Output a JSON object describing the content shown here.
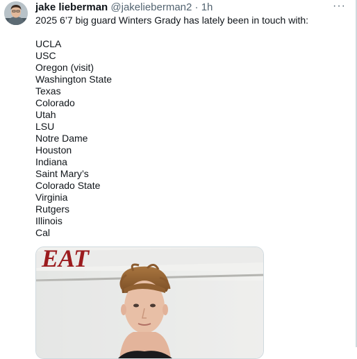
{
  "tweet": {
    "author_name": "jake lieberman",
    "handle": "@jakelieberman2",
    "separator": "·",
    "time": "1h",
    "more_icon": "more-horizontal-icon",
    "text": "2025 6’7 big guard Winters Grady has lately been in touch with:\n\nUCLA\nUSC\nOregon (visit)\nWashington State\nTexas\nColorado\nUtah\nLSU\nNotre Dame\nHouston\nIndiana\nSaint Mary’s\nColorado State\nVirginia\nRutgers\nIllinois\nCal",
    "media_sign_text": "EAT"
  },
  "colors": {
    "text": "#0f1419",
    "secondary_text": "#536471",
    "border": "#cfd9de",
    "banner_red": "#9b1b1e"
  }
}
